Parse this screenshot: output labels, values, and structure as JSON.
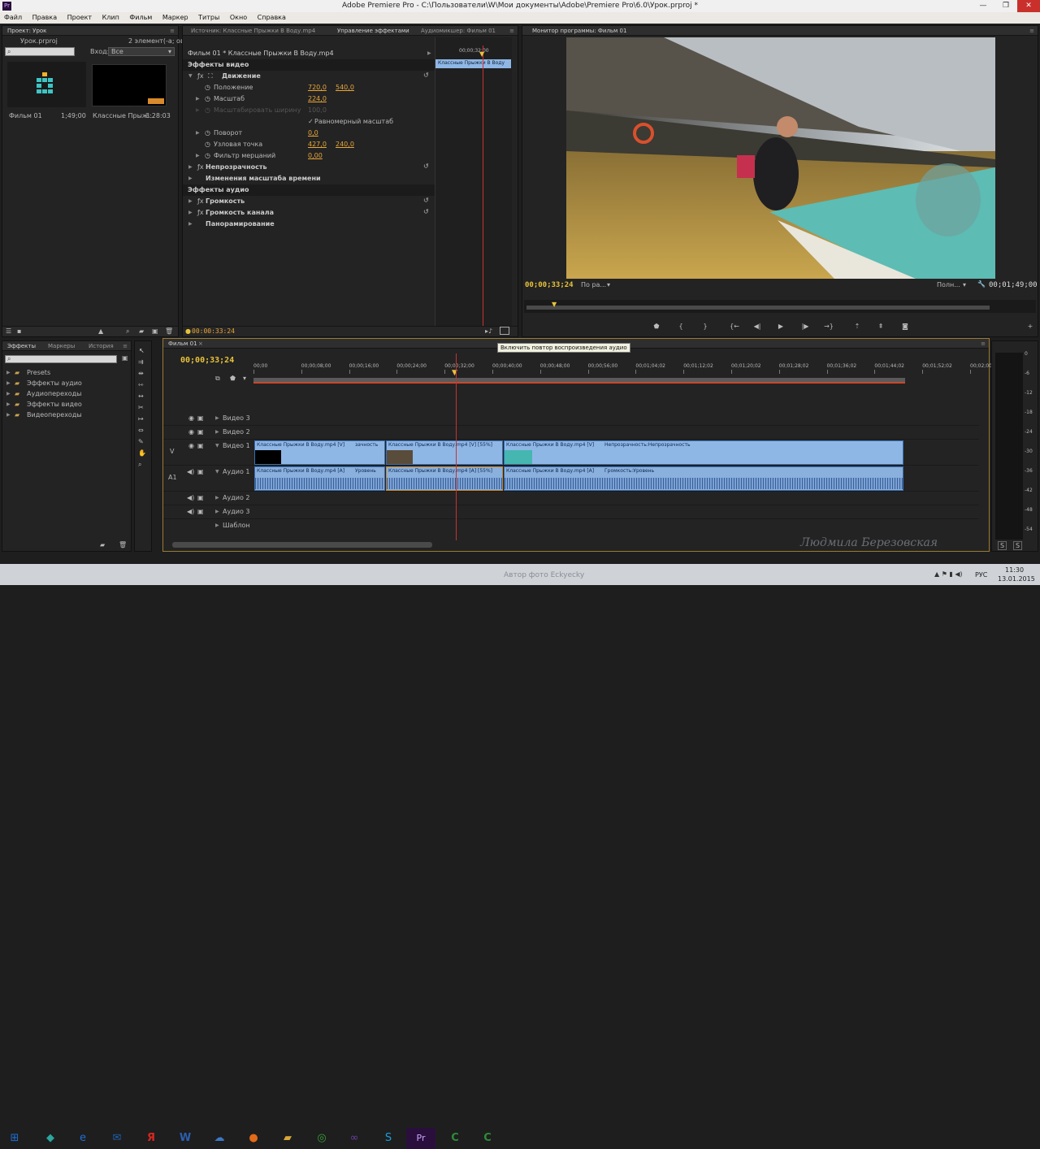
{
  "window": {
    "title": "Adobe Premiere Pro - C:\\Пользователи\\W\\Мои документы\\Adobe\\Premiere Pro\\6.0\\Урок.prproj *",
    "app_icon": "Pr"
  },
  "menu": [
    "Файл",
    "Правка",
    "Проект",
    "Клип",
    "Фильм",
    "Маркер",
    "Титры",
    "Окно",
    "Справка"
  ],
  "project": {
    "tab": "Проект: Урок",
    "file": "Урок.prproj",
    "count": "2 элемент(-а; ов)",
    "search_placeholder": "",
    "in_label": "Вход:",
    "in_value": "Все",
    "items": [
      {
        "name": "Фильм 01",
        "duration": "1;49;00"
      },
      {
        "name": "Классные Прыж...",
        "duration": "3:28:03"
      }
    ]
  },
  "effect_controls": {
    "tabs": [
      "Источник: Классные Прыжки В Воду.mp4",
      "Управление эффектами",
      "Аудиомикшер: Фильм 01"
    ],
    "active_tab": "Управление эффектами",
    "clip_path": "Фильм 01 * Классные Прыжки В Воду.mp4",
    "mini_timecode": "00;00;32;00",
    "mini_clip": "Классные Прыжки В Воду",
    "video_effects": "Эффекты видео",
    "motion": "Движение",
    "position": {
      "label": "Положение",
      "x": "720,0",
      "y": "540,0"
    },
    "scale": {
      "label": "Масштаб",
      "value": "224,0"
    },
    "scale_width": {
      "label": "Масштабировать ширину",
      "value": "100,0"
    },
    "uniform": "Равномерный масштаб",
    "rotation": {
      "label": "Поворот",
      "value": "0,0"
    },
    "anchor": {
      "label": "Узловая точка",
      "x": "427,0",
      "y": "240,0"
    },
    "flicker": {
      "label": "Фильтр мерцаний",
      "value": "0,00"
    },
    "opacity": "Непрозрачность",
    "time_remap": "Изменения масштаба времени",
    "audio_effects": "Эффекты аудио",
    "volume": "Громкость",
    "channel_volume": "Громкость канала",
    "panner": "Панорамирование",
    "timecode": "00:00:33:24",
    "tooltip": "Включить повтор воспроизведения аудио"
  },
  "program_monitor": {
    "tab": "Монитор программы: Фильм 01",
    "timecode": "00;00;33;24",
    "fit": "По ра...",
    "quality": "Полн...",
    "duration": "00;01;49;00"
  },
  "effects_panel": {
    "tabs": [
      "Эффекты",
      "Маркеры",
      "История"
    ],
    "items": [
      "Presets",
      "Эффекты аудио",
      "Аудиопереходы",
      "Эффекты видео",
      "Видеопереходы"
    ]
  },
  "timeline": {
    "tab": "Фильм 01",
    "timecode": "00;00;33;24",
    "ruler": [
      "00;00",
      "00;00;08;00",
      "00;00;16;00",
      "00;00;24;00",
      "00;00;32;00",
      "00;00;40;00",
      "00;00;48;00",
      "00;00;56;00",
      "00;01;04;02",
      "00;01;12;02",
      "00;01;20;02",
      "00;01;28;02",
      "00;01;36;02",
      "00;01;44;02",
      "00;01;52;02",
      "00;02;00;"
    ],
    "tracks": {
      "v3": "Видео 3",
      "v2": "Видео 2",
      "v1": "Видео 1",
      "a1": "Аудио 1",
      "a2": "Аудио 2",
      "a3": "Аудио 3",
      "master": "Шаблон",
      "v_label": "V",
      "a_label": "A1"
    },
    "clips": {
      "v1": "Классные Прыжки В Воду.mp4 [V]",
      "v1_fx": "зачность",
      "v2": "Классные Прыжки В Воду.mp4 [V] [55%]",
      "v3": "Классные Прыжки В Воду.mp4 [V]",
      "v3_fx": "Непрозрачность:Непрозрачность",
      "a1": "Классные Прыжки В Воду.mp4 [A]",
      "a1_fx": "Уровень",
      "a2": "Классные Прыжки В Воду.mp4 [A] [55%]",
      "a3": "Классные Прыжки В Воду.mp4 [A]",
      "a3_fx": "Громкость:Уровень"
    }
  },
  "meters": [
    "0",
    "-6",
    "-12",
    "-18",
    "-24",
    "-30",
    "-36",
    "-42",
    "-48",
    "-54"
  ],
  "watermark": "Людмила Березовская",
  "taskbar": {
    "author": "Автор фото Eckyecky",
    "lang": "РУС",
    "time": "11:30",
    "date": "13.01.2015"
  }
}
